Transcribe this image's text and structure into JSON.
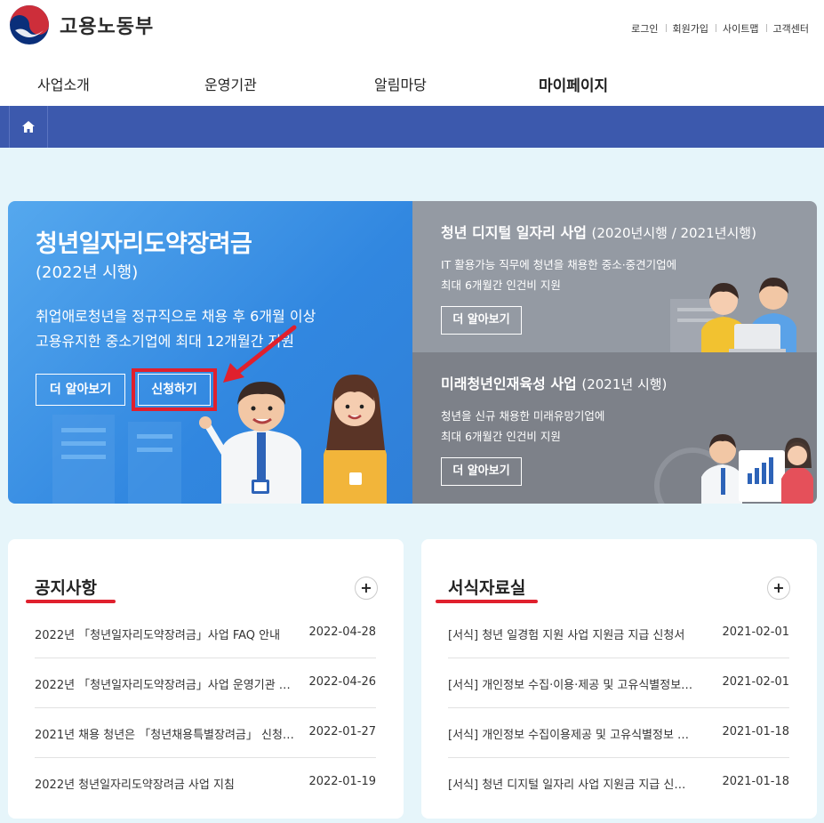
{
  "header": {
    "logo_text": "고용노동부",
    "util_links": [
      "로그인",
      "회원가입",
      "사이트맵",
      "고객센터"
    ]
  },
  "gnb": {
    "items": [
      "사업소개",
      "운영기관",
      "알림마당",
      "마이페이지"
    ]
  },
  "locbar": {
    "home_icon": "home-icon"
  },
  "hero": {
    "title": "청년일자리도약장려금",
    "subtitle": "(2022년 시행)",
    "desc_line1": "취업애로청년을 정규직으로 채용 후 6개월 이상",
    "desc_line2": "고용유지한 중소기업에 최대 12개월간 지원",
    "more_label": "더 알아보기",
    "apply_label": "신청하기"
  },
  "digital": {
    "title": "청년 디지털 일자리 사업",
    "title_suffix": "(2020년시행 / 2021년시행)",
    "desc_line1": "IT 활용가능 직무에 청년을 채용한 중소·중견기업에",
    "desc_line2": "최대 6개월간 인건비 지원",
    "more_label": "더 알아보기"
  },
  "future": {
    "title": "미래청년인재육성 사업",
    "title_suffix": "(2021년 시행)",
    "desc_line1": "청년을 신규 채용한 미래유망기업에",
    "desc_line2": "최대 6개월간 인건비 지원",
    "more_label": "더 알아보기"
  },
  "notice": {
    "title": "공지사항",
    "plus": "+",
    "items": [
      {
        "title": "2022년 「청년일자리도약장려금」사업 FAQ 안내",
        "date": "2022-04-28"
      },
      {
        "title": "2022년 「청년일자리도약장려금」사업 운영기관 …",
        "date": "2022-04-26"
      },
      {
        "title": "2021년 채용 청년은 「청년채용특별장려금」 신청…",
        "date": "2022-01-27"
      },
      {
        "title": "2022년 청년일자리도약장려금 사업 지침",
        "date": "2022-01-19"
      }
    ]
  },
  "forms": {
    "title": "서식자료실",
    "plus": "+",
    "items": [
      {
        "title": "[서식] 청년 일경험 지원 사업 지원금 지급 신청서",
        "date": "2021-02-01"
      },
      {
        "title": "[서식] 개인정보 수집·이용·제공 및 고유식별정보…",
        "date": "2021-02-01"
      },
      {
        "title": "[서식] 개인정보 수집이용제공 및 고유식별정보 …",
        "date": "2021-01-18"
      },
      {
        "title": "[서식] 청년 디지털 일자리 사업 지원금 지급 신…",
        "date": "2021-01-18"
      }
    ]
  },
  "colors": {
    "brand_blue": "#3c59ad",
    "hero_blue": "#3187e0",
    "highlight_red": "#e0202d"
  }
}
